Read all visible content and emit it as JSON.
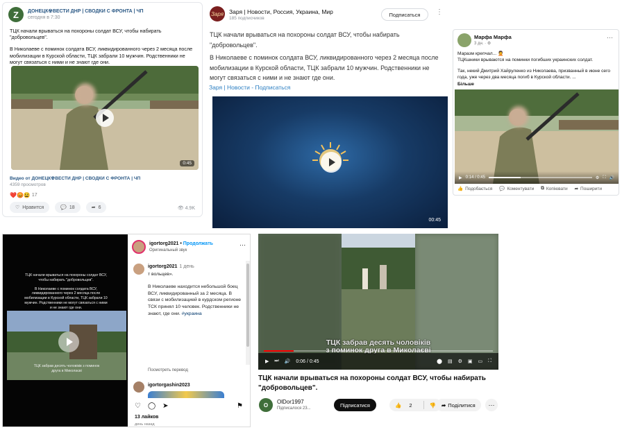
{
  "vk": {
    "avatar_letter": "Z",
    "channel": "ДОНЕЦК☢ВЕСТИ ДНР | СВОДКИ С ФРОНТА | ЧП",
    "time": "сегодня в 7:30",
    "paragraphs": [
      "ТЦК начали врываться на похороны солдат ВСУ, чтобы набирать \"добровольцев\".",
      "В Николаеве с поминок солдата ВСУ, ликвидированного через 2 месяца после мобилизации в Курской области, ТЦК забрали 10 мужчин. Родственники не могут связаться с ними и не знают где они."
    ],
    "video_duration": "0:45",
    "video_title": "Видео от ДОНЕЦК☢ВЕСТИ ДНР | СВОДКИ С ФРОНТА | ЧП",
    "views": "4359 просмотров",
    "reaction_count": "17",
    "like_label": "Нравится",
    "comment_count": "18",
    "share_count": "6",
    "view_count": "4.9K"
  },
  "zarya": {
    "logo_text": "Заря",
    "name": "Заря | Новости, Россия, Украина, Мир",
    "subscribers": "185 подписчиков",
    "subscribe_label": "Подписаться",
    "more_icon": "⋮",
    "paragraphs": [
      "ТЦК начали врываться на похороны солдат ВСУ, чтобы набирать \"добровольцев\".",
      "В Николаеве с поминок солдата ВСУ, ликвидированного через 2 месяца после мобилизации в Курской области, ТЦК забрали 10 мужчин. Родственники не могут связаться с ними и не знают где они."
    ],
    "link": "Заря | Новости - Подписаться",
    "video_duration": "00:45"
  },
  "facebook": {
    "user": "Марфа Марфа",
    "meta": "3 дн. · ⚙",
    "line1": "Маразм крепчал... 🤦",
    "line2": "ТЦКшники врываются на поминки погибших украинских солдат.",
    "line3": "Так, некий Дмитрий Хайруленко из Николаева, призванный в июне сего года, уже через два месяца погиб в Курской области. ...",
    "more_link": "Більше",
    "time_display": "0:14 / 0:45",
    "progress": 0.31,
    "actions": [
      "Подобається",
      "Коментувати",
      "Копіювати",
      "Поширити"
    ]
  },
  "instagram": {
    "story_paragraphs": [
      "ТЦК начали врываться на похороны солдат ВСУ, чтобы набирать \"добровольцев\".",
      "В Николаеве с поминок солдата ВСУ, ликвидированного через 2 месяца после мобилизации в Курской области, ТЦК забрали 10 мужчин. Родственники не могут связаться с ними и не знают где они."
    ],
    "story_caption": "ТЦК забрав десять чоловіків з поминок друга в Миколаєві",
    "user": "igortorg2021",
    "follow": "Продолжать",
    "audio": "Оригинальный звук",
    "comment_user": "igortorg2021",
    "comment_age": "1 день",
    "comment_lead": "т вольцев».",
    "comment_body": "В Николаеве находится небольшой боец ВСУ, ликвидированный за 2 месяца. В связи с мобилизацией в курдском регионе ТСК принял 10 человек. Родственники не знают, где они.",
    "hashtag": "#украина",
    "translate": "Посмотреть перевод",
    "comment2_user": "igortorgashin2023",
    "likes": "13 лайков",
    "date": "день назад"
  },
  "youtube": {
    "caption_line1": "ТЦК забрав десять чоловіків",
    "caption_line2": "з поминок друга в Миколаєві",
    "time": "0:06 / 0:45",
    "progress": 0.13,
    "title": "ТЦК начали врываться на похороны солдат ВСУ, чтобы набирать \"добровольцев\".",
    "channel": "OlDor1997",
    "avatar_letter": "O",
    "channel_subs": "Підписалося 23...",
    "subscribe_label": "Підписатися",
    "likes": "2",
    "share_label": "Поділитися",
    "more_icon": "⋯"
  }
}
